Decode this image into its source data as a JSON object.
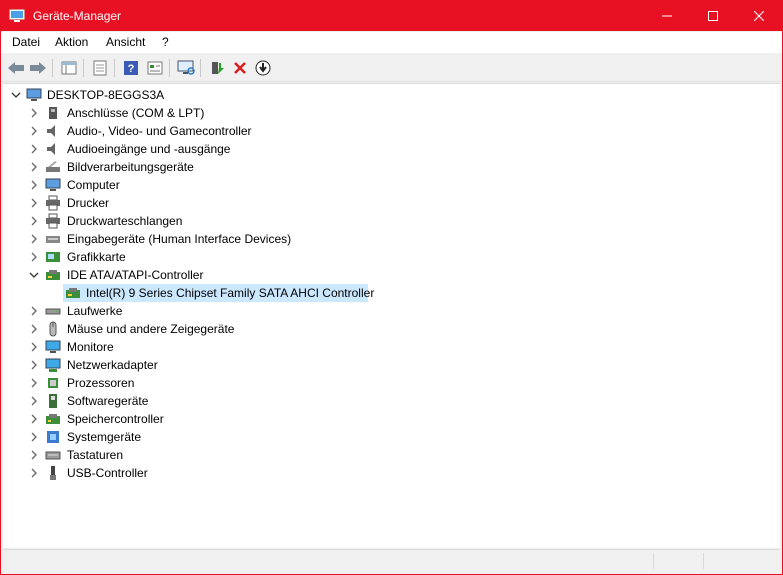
{
  "window": {
    "title": "Geräte-Manager"
  },
  "menu": [
    "Datei",
    "Aktion",
    "Ansicht",
    "?"
  ],
  "toolbar": {
    "buttons": [
      {
        "name": "back-arrow-icon"
      },
      {
        "name": "forward-arrow-icon"
      },
      {
        "name": "show-hide-tree-icon"
      },
      {
        "name": "properties-sheet-icon"
      },
      {
        "name": "help-icon"
      },
      {
        "name": "view-icon"
      },
      {
        "name": "monitor-scan-icon"
      },
      {
        "name": "update-driver-icon"
      },
      {
        "name": "uninstall-x-icon"
      },
      {
        "name": "download-disable-icon"
      }
    ]
  },
  "tree": {
    "root": "DESKTOP-8EGGS3A",
    "categories": [
      {
        "label": "Anschlüsse (COM & LPT)",
        "icon": "port-icon"
      },
      {
        "label": "Audio-, Video- und Gamecontroller",
        "icon": "speaker-icon"
      },
      {
        "label": "Audioeingänge und -ausgänge",
        "icon": "speaker-icon"
      },
      {
        "label": "Bildverarbeitungsgeräte",
        "icon": "scanner-icon"
      },
      {
        "label": "Computer",
        "icon": "computer-icon"
      },
      {
        "label": "Drucker",
        "icon": "printer-icon"
      },
      {
        "label": "Druckwarteschlangen",
        "icon": "printer-icon"
      },
      {
        "label": "Eingabegeräte (Human Interface Devices)",
        "icon": "hid-icon"
      },
      {
        "label": "Grafikkarte",
        "icon": "display-adapter-icon"
      },
      {
        "label": "IDE ATA/ATAPI-Controller",
        "icon": "ide-controller-icon",
        "expanded": true,
        "children": [
          {
            "label": "Intel(R) 9 Series Chipset Family SATA AHCI Controller",
            "icon": "ide-controller-icon",
            "selected": true
          }
        ]
      },
      {
        "label": "Laufwerke",
        "icon": "drive-icon"
      },
      {
        "label": "Mäuse und andere Zeigegeräte",
        "icon": "mouse-icon"
      },
      {
        "label": "Monitore",
        "icon": "monitor-icon"
      },
      {
        "label": "Netzwerkadapter",
        "icon": "network-adapter-icon"
      },
      {
        "label": "Prozessoren",
        "icon": "processor-icon"
      },
      {
        "label": "Softwaregeräte",
        "icon": "software-device-icon"
      },
      {
        "label": "Speichercontroller",
        "icon": "storage-controller-icon"
      },
      {
        "label": "Systemgeräte",
        "icon": "system-device-icon"
      },
      {
        "label": "Tastaturen",
        "icon": "keyboard-icon"
      },
      {
        "label": "USB-Controller",
        "icon": "usb-icon"
      }
    ]
  },
  "colors": {
    "titlebar": "#e81123",
    "selection": "#cce8ff"
  }
}
